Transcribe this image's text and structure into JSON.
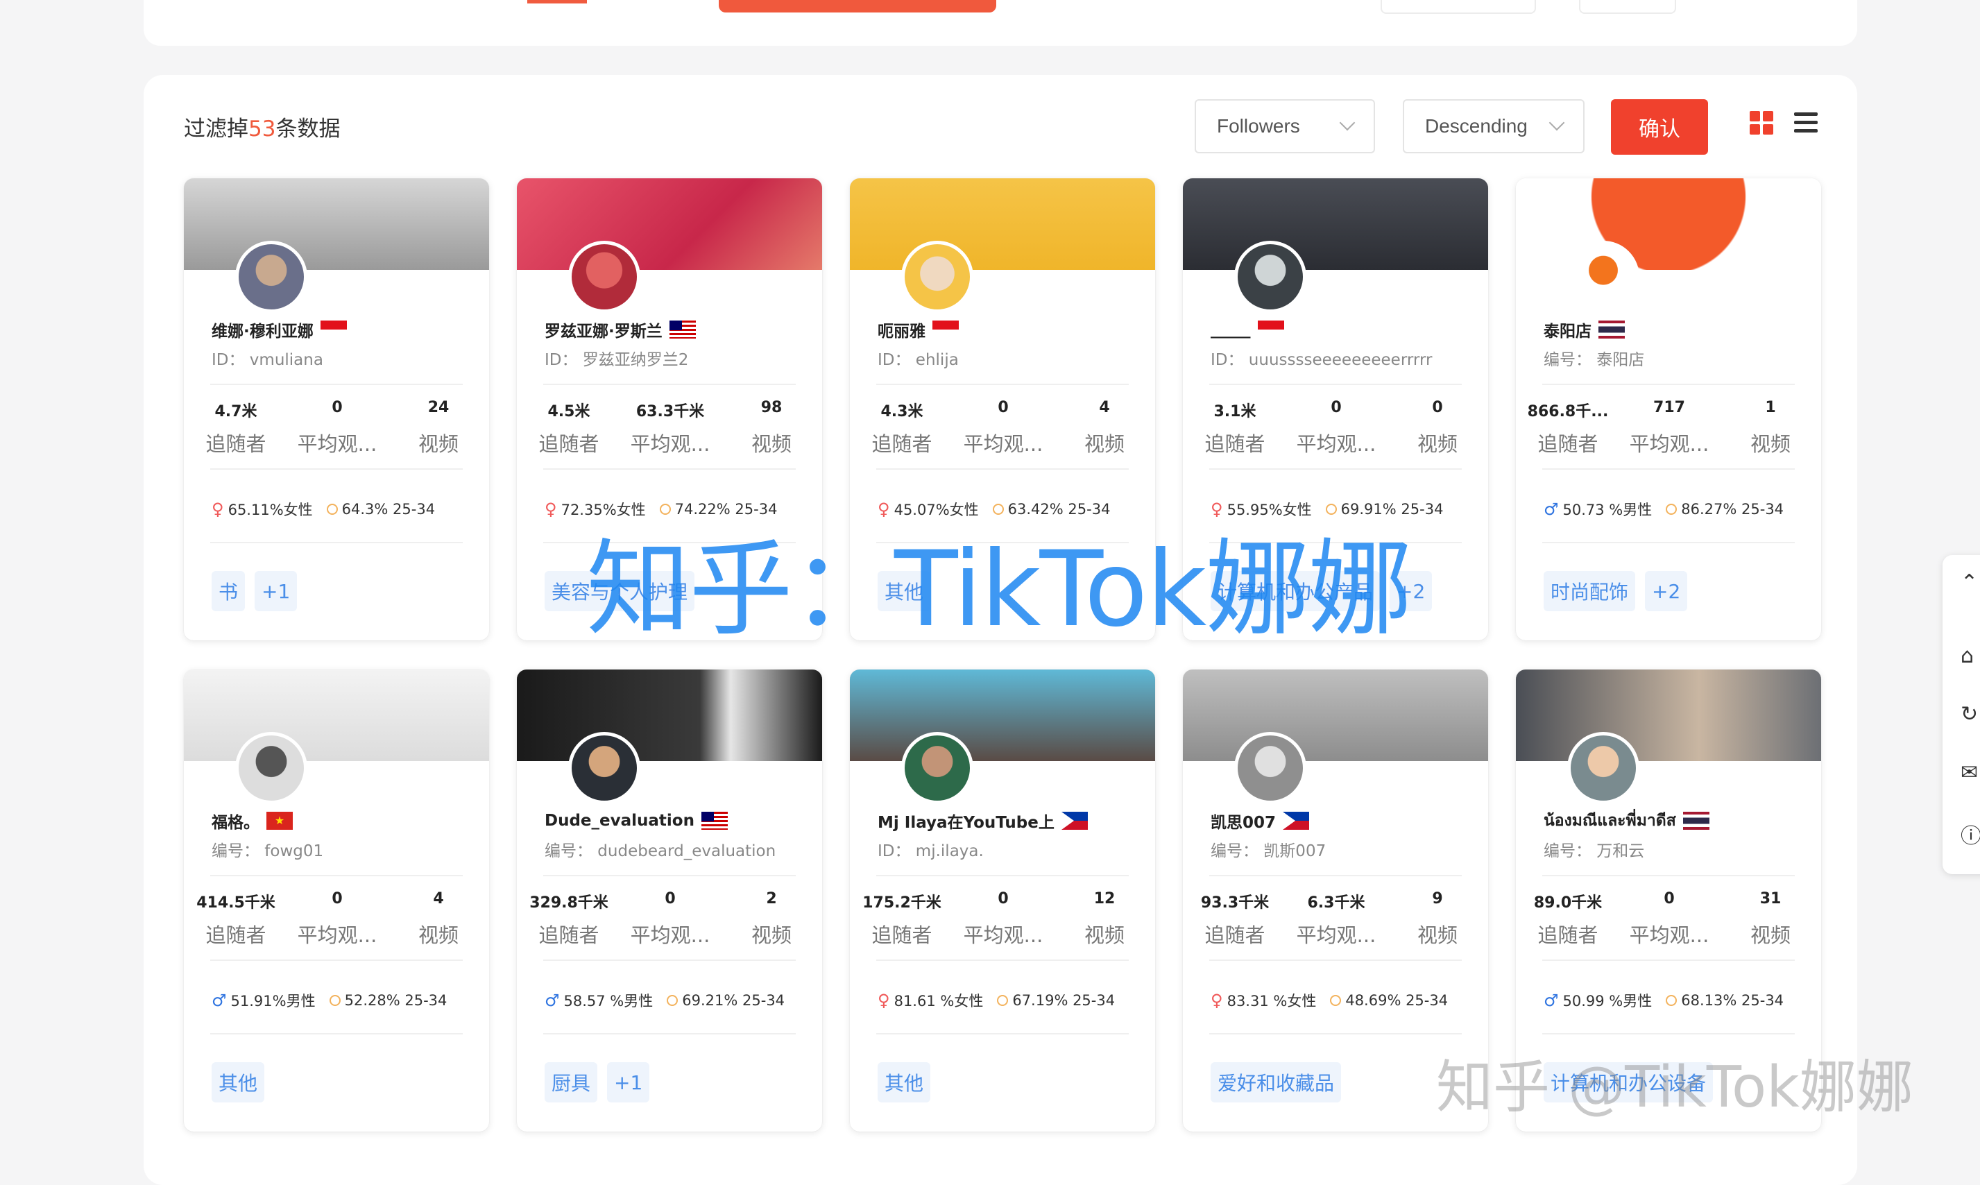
{
  "filter": {
    "prefix": "过滤掉",
    "count": "53",
    "suffix": "条数据"
  },
  "sort_field": "Followers",
  "sort_order": "Descending",
  "confirm_label": "确认",
  "labels": {
    "followers": "追随者",
    "avg_views": "平均观...",
    "videos": "视频"
  },
  "accent_color": "#f0412d",
  "watermark_center": "知乎：TikTok娜娜",
  "watermark_corner": "知乎 @TikTok娜娜",
  "cards": [
    {
      "name": "维娜·穆利亚娜",
      "flag": "indonesia",
      "id": "ID：  vmuliana",
      "followers": "4.7米",
      "avg_views": "0",
      "videos": "24",
      "gender_icon": "female",
      "gender": "65.11%女性",
      "age": "64.3% 25-34",
      "tags": [
        "书",
        "+1"
      ]
    },
    {
      "name": "罗兹亚娜·罗斯兰",
      "flag": "malaysia",
      "id": "ID：  罗兹亚纳罗兰2",
      "followers": "4.5米",
      "avg_views": "63.3千米",
      "videos": "98",
      "gender_icon": "female",
      "gender": "72.35%女性",
      "age": "74.22% 25-34",
      "tags": [
        "美容与个人护理"
      ]
    },
    {
      "name": "呃丽雅",
      "flag": "indonesia",
      "id": "ID：  ehlija",
      "followers": "4.3米",
      "avg_views": "0",
      "videos": "4",
      "gender_icon": "female",
      "gender": "45.07%女性",
      "age": "63.42% 25-34",
      "tags": [
        "其他"
      ]
    },
    {
      "name": "_____",
      "flag": "indonesia",
      "id": "ID：  uuusssseeeeeeeeerrrrr",
      "followers": "3.1米",
      "avg_views": "0",
      "videos": "0",
      "gender_icon": "female",
      "gender": "55.95%女性",
      "age": "69.91% 25-34",
      "tags": [
        "计算机和办公产品",
        "+2"
      ]
    },
    {
      "name": "泰阳店",
      "flag": "thailand",
      "id": "编号：  泰阳店",
      "followers": "866.8千...",
      "avg_views": "717",
      "videos": "1",
      "gender_icon": "male",
      "gender": "50.73 %男性",
      "age": "86.27% 25-34",
      "tags": [
        "时尚配饰",
        "+2"
      ]
    },
    {
      "name": "福格。",
      "flag": "vietnam",
      "id": "编号：  fowg01",
      "followers": "414.5千米",
      "avg_views": "0",
      "videos": "4",
      "gender_icon": "male",
      "gender": "51.91%男性",
      "age": "52.28% 25-34",
      "tags": [
        "其他"
      ]
    },
    {
      "name": "Dude_evaluation",
      "flag": "malaysia",
      "id": "编号：  dudebeard_evaluation",
      "followers": "329.8千米",
      "avg_views": "0",
      "videos": "2",
      "gender_icon": "male",
      "gender": "58.57 %男性",
      "age": "69.21% 25-34",
      "tags": [
        "厨具",
        "+1"
      ]
    },
    {
      "name": "Mj Ilaya在YouTube上",
      "flag": "philippines",
      "id": "ID：  mj.ilaya.",
      "followers": "175.2千米",
      "avg_views": "0",
      "videos": "12",
      "gender_icon": "female",
      "gender": "81.61 %女性",
      "age": "67.19% 25-34",
      "tags": [
        "其他"
      ]
    },
    {
      "name": "凯思007",
      "flag": "philippines",
      "id": "编号：  凯斯007",
      "followers": "93.3千米",
      "avg_views": "6.3千米",
      "videos": "9",
      "gender_icon": "female",
      "gender": "83.31 %女性",
      "age": "48.69% 25-34",
      "tags": [
        "爱好和收藏品"
      ]
    },
    {
      "name": "น้องมณีและพี่มาดีส",
      "flag": "thailand",
      "id": "编号：  万和云",
      "followers": "89.0千米",
      "avg_views": "0",
      "videos": "31",
      "gender_icon": "male",
      "gender": "50.99 %男性",
      "age": "68.13% 25-34",
      "tags": [
        "计算机和办公设备"
      ]
    }
  ]
}
